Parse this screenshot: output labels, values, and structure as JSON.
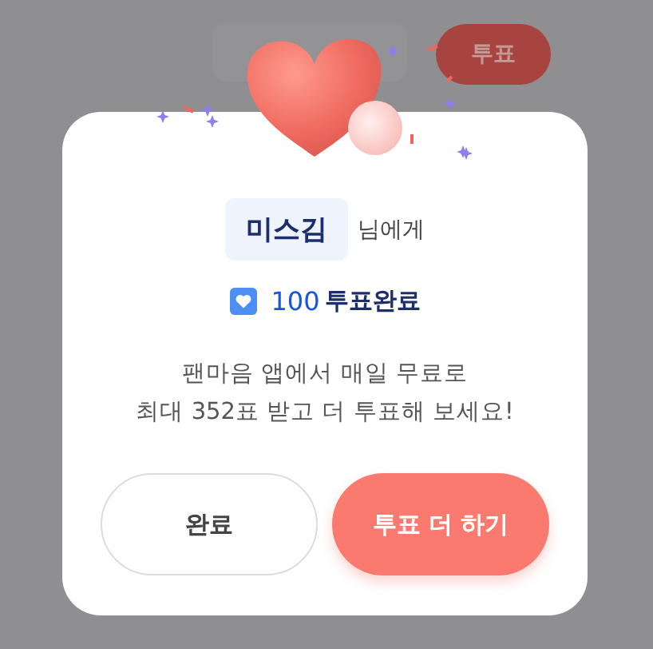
{
  "top_bar": {
    "vote_button": "투표"
  },
  "dialog": {
    "recipient": "미스김",
    "recipient_suffix": "님에게",
    "votes": "100",
    "votes_label": "투표완료",
    "message": [
      "팬마음 앱에서 매일 무료로",
      "최대 352표 받고 더 투표해 보세요!"
    ],
    "buttons": [
      {
        "label": "완료",
        "kind": "secondary"
      },
      {
        "label": "투표 더 하기",
        "kind": "primary"
      }
    ]
  }
}
